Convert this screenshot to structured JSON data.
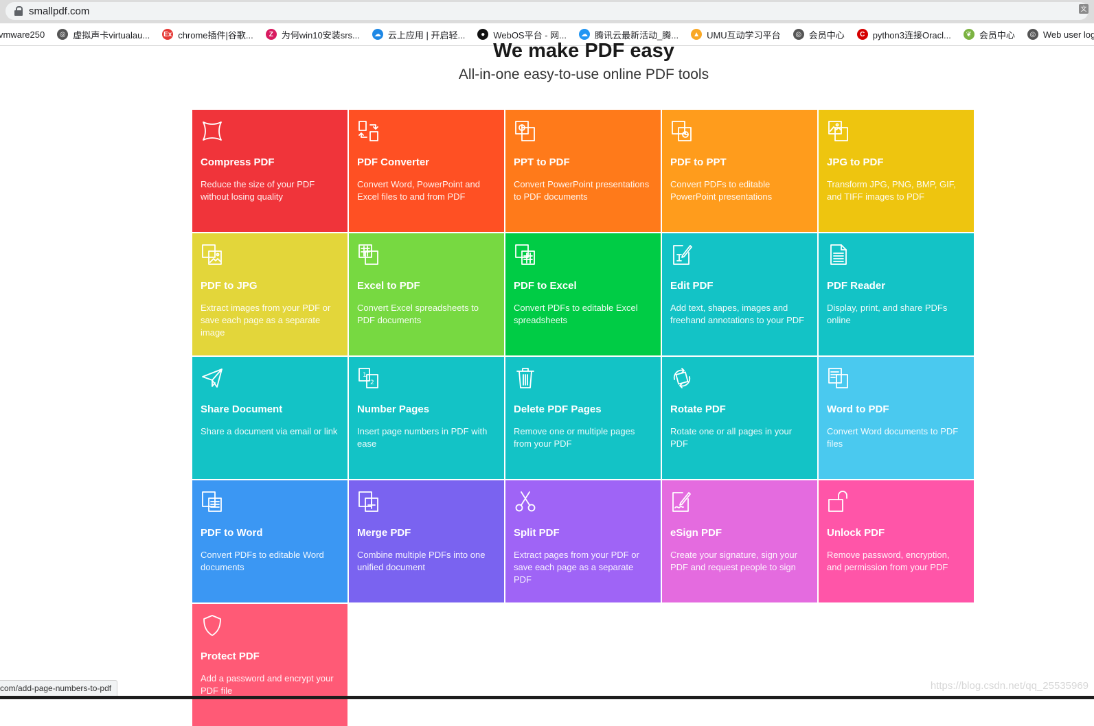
{
  "browser": {
    "url": "smallpdf.com",
    "status_url": "com/add-page-numbers-to-pdf",
    "bookmarks": [
      {
        "label": "vmware250",
        "icon": "none",
        "color": ""
      },
      {
        "label": "虚拟声卡virtualau...",
        "icon": "globe-icon",
        "color": "#555555"
      },
      {
        "label": "chrome插件|谷歌...",
        "icon": "ex-icon",
        "color": "#e53935"
      },
      {
        "label": "为何win10安装srs...",
        "icon": "z-icon",
        "color": "#d81b60"
      },
      {
        "label": "云上应用 | 开启轻...",
        "icon": "cloud-icon",
        "color": "#1e88e5"
      },
      {
        "label": "WebOS平台 - 网...",
        "icon": "circle-icon",
        "color": "#111111"
      },
      {
        "label": "腾讯云最新活动_腾...",
        "icon": "tencent-cloud-icon",
        "color": "#2196f3"
      },
      {
        "label": "UMU互动学习平台",
        "icon": "umu-icon",
        "color": "#f9a825"
      },
      {
        "label": "会员中心",
        "icon": "globe-icon",
        "color": "#555555"
      },
      {
        "label": "python3连接Oracl...",
        "icon": "c-icon",
        "color": "#d50000"
      },
      {
        "label": "会员中心",
        "icon": "leaf-icon",
        "color": "#7cb342"
      },
      {
        "label": "Web user login",
        "icon": "globe-icon",
        "color": "#555555"
      }
    ]
  },
  "hero": {
    "title": "We make PDF easy",
    "subtitle": "All-in-one easy-to-use online PDF tools"
  },
  "tools": [
    {
      "title": "Compress PDF",
      "desc": "Reduce the size of your PDF without losing quality",
      "color": "#f0343a",
      "icon": "compress-icon"
    },
    {
      "title": "PDF Converter",
      "desc": "Convert Word, PowerPoint and Excel files to and from PDF",
      "color": "#ff5023",
      "icon": "converter-icon"
    },
    {
      "title": "PPT to PDF",
      "desc": "Convert PowerPoint presentations to PDF documents",
      "color": "#ff7a1a",
      "icon": "ppt-to-pdf-icon"
    },
    {
      "title": "PDF to PPT",
      "desc": "Convert PDFs to editable PowerPoint presentations",
      "color": "#ff9c1c",
      "icon": "pdf-to-ppt-icon"
    },
    {
      "title": "JPG to PDF",
      "desc": "Transform JPG, PNG, BMP, GIF, and TIFF images to PDF",
      "color": "#eec50f",
      "icon": "jpg-to-pdf-icon"
    },
    {
      "title": "PDF to JPG",
      "desc": "Extract images from your PDF or save each page as a separate image",
      "color": "#e3d63a",
      "icon": "pdf-to-jpg-icon"
    },
    {
      "title": "Excel to PDF",
      "desc": "Convert Excel spreadsheets to PDF documents",
      "color": "#77d941",
      "icon": "excel-to-pdf-icon"
    },
    {
      "title": "PDF to Excel",
      "desc": "Convert PDFs to editable Excel spreadsheets",
      "color": "#00cc45",
      "icon": "pdf-to-excel-icon"
    },
    {
      "title": "Edit PDF",
      "desc": "Add text, shapes, images and freehand annotations to your PDF",
      "color": "#13c3c6",
      "icon": "edit-pdf-icon"
    },
    {
      "title": "PDF Reader",
      "desc": "Display, print, and share PDFs online",
      "color": "#13c3c6",
      "icon": "pdf-reader-icon"
    },
    {
      "title": "Share Document",
      "desc": "Share a document via email or link",
      "color": "#13c3c6",
      "icon": "share-icon"
    },
    {
      "title": "Number Pages",
      "desc": "Insert page numbers in PDF with ease",
      "color": "#13c3c6",
      "icon": "number-pages-icon"
    },
    {
      "title": "Delete PDF Pages",
      "desc": "Remove one or multiple pages from your PDF",
      "color": "#13c3c6",
      "icon": "trash-icon"
    },
    {
      "title": "Rotate PDF",
      "desc": "Rotate one or all pages in your PDF",
      "color": "#13c3c6",
      "icon": "rotate-icon"
    },
    {
      "title": "Word to PDF",
      "desc": "Convert Word documents to PDF files",
      "color": "#4ac9ef",
      "icon": "word-to-pdf-icon"
    },
    {
      "title": "PDF to Word",
      "desc": "Convert PDFs to editable Word documents",
      "color": "#3b97f3",
      "icon": "pdf-to-word-icon"
    },
    {
      "title": "Merge PDF",
      "desc": "Combine multiple PDFs into one unified document",
      "color": "#7a63f0",
      "icon": "merge-icon"
    },
    {
      "title": "Split PDF",
      "desc": "Extract pages from your PDF or save each page as a separate PDF",
      "color": "#9f64f6",
      "icon": "scissors-icon"
    },
    {
      "title": "eSign PDF",
      "desc": "Create your signature, sign your PDF and request people to sign",
      "color": "#e46bdf",
      "icon": "esign-icon"
    },
    {
      "title": "Unlock PDF",
      "desc": "Remove password, encryption, and permission from your PDF",
      "color": "#ff55a8",
      "icon": "unlock-icon"
    },
    {
      "title": "Protect PDF",
      "desc": "Add a password and encrypt your PDF file",
      "color": "#ff5a76",
      "icon": "shield-icon"
    }
  ],
  "watermark": "https://blog.csdn.net/qq_25535969"
}
